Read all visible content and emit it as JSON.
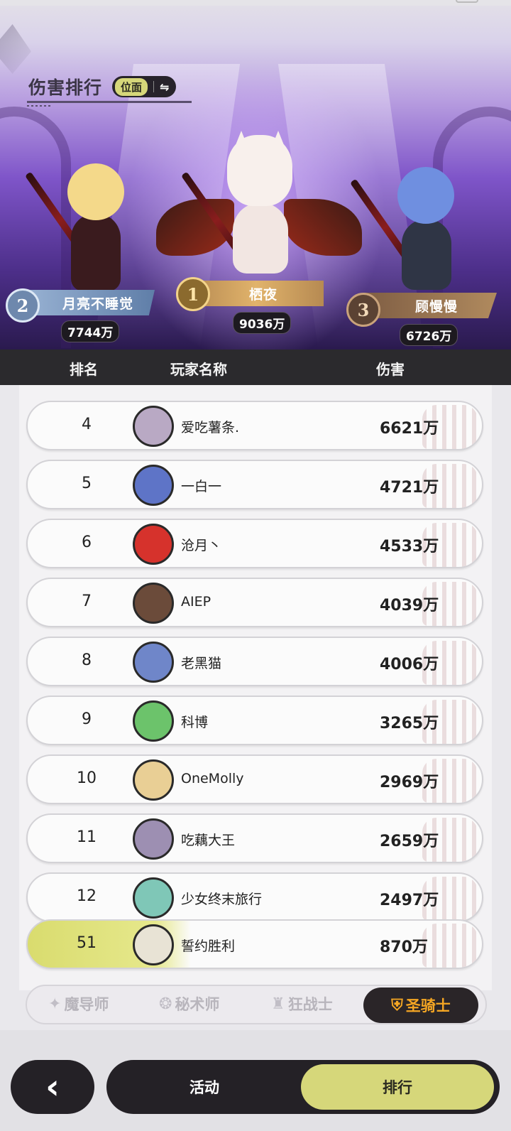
{
  "header": {
    "title": "伤害排行",
    "mode_label": "位面",
    "swap_icon": "⇋"
  },
  "podium": [
    {
      "place": "1",
      "name": "栖夜",
      "score": "9036万"
    },
    {
      "place": "2",
      "name": "月亮不睡觉",
      "score": "7744万"
    },
    {
      "place": "3",
      "name": "顾慢慢",
      "score": "6726万"
    }
  ],
  "table": {
    "columns": {
      "rank": "排名",
      "name": "玩家名称",
      "damage": "伤害"
    },
    "rows": [
      {
        "rank": "4",
        "name": "爱吃薯条.",
        "damage": "6621万",
        "avatar_color": "#b9a9c4"
      },
      {
        "rank": "5",
        "name": "一白一",
        "damage": "4721万",
        "avatar_color": "#5e74c7"
      },
      {
        "rank": "6",
        "name": "沧月丶",
        "damage": "4533万",
        "avatar_color": "#d6322c"
      },
      {
        "rank": "7",
        "name": "AIEP",
        "damage": "4039万",
        "avatar_color": "#6b4b3a"
      },
      {
        "rank": "8",
        "name": "老黑猫",
        "damage": "4006万",
        "avatar_color": "#6f86c9"
      },
      {
        "rank": "9",
        "name": "科博",
        "damage": "3265万",
        "avatar_color": "#6cc36b"
      },
      {
        "rank": "10",
        "name": "OneMolly",
        "damage": "2969万",
        "avatar_color": "#e9cf95"
      },
      {
        "rank": "11",
        "name": "吃藕大王",
        "damage": "2659万",
        "avatar_color": "#9d8fb2"
      },
      {
        "rank": "12",
        "name": "少女终末旅行",
        "damage": "2497万",
        "avatar_color": "#7fc7b7"
      },
      {
        "rank": "51",
        "name": "誓约胜利",
        "damage": "870万",
        "avatar_color": "#e8e3d5",
        "self": true
      }
    ]
  },
  "class_tabs": [
    {
      "label": "魔导师",
      "icon": "mage-icon"
    },
    {
      "label": "秘术师",
      "icon": "arcanist-icon"
    },
    {
      "label": "狂战士",
      "icon": "berserker-icon"
    },
    {
      "label": "圣骑士",
      "icon": "paladin-icon",
      "active": true
    }
  ],
  "bottom_nav": {
    "back_icon": "‹",
    "activity": "活动",
    "ranking": "排行"
  },
  "colors": {
    "accent": "#d6d77a",
    "active_tab_text": "#f5a623",
    "dark": "#242126"
  }
}
